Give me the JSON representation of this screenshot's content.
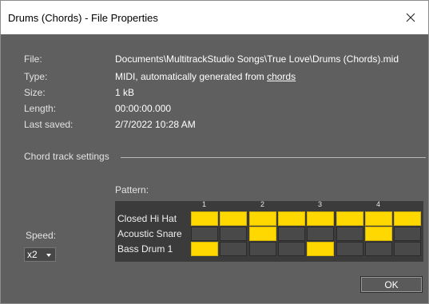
{
  "window": {
    "title": "Drums (Chords) - File Properties",
    "close_icon": "close-icon"
  },
  "properties": [
    {
      "label": "File:",
      "value": "Documents\\MultitrackStudio Songs\\True Love\\Drums (Chords).mid"
    },
    {
      "label": "Type:",
      "value_prefix": "MIDI, automatically generated from ",
      "link": "chords"
    },
    {
      "label": "Size:",
      "value": "1 kB"
    },
    {
      "label": "Length:",
      "value": "00:00:00.000"
    },
    {
      "label": "Last saved:",
      "value": "2/7/2022 10:28 AM"
    }
  ],
  "chord_settings": {
    "section_label": "Chord track settings",
    "pattern_label": "Pattern:",
    "beats": [
      "1",
      "2",
      "3",
      "4"
    ],
    "rows": [
      {
        "name": "Closed Hi Hat",
        "steps": [
          1,
          1,
          1,
          1,
          1,
          1,
          1,
          1
        ]
      },
      {
        "name": "Acoustic Snare",
        "steps": [
          0,
          0,
          1,
          0,
          0,
          0,
          1,
          0
        ]
      },
      {
        "name": "Bass Drum 1",
        "steps": [
          1,
          0,
          0,
          0,
          1,
          0,
          0,
          0
        ]
      }
    ],
    "on_color": "#ffd800",
    "speed_label": "Speed:",
    "speed_value": "x2"
  },
  "buttons": {
    "ok_label": "OK"
  }
}
